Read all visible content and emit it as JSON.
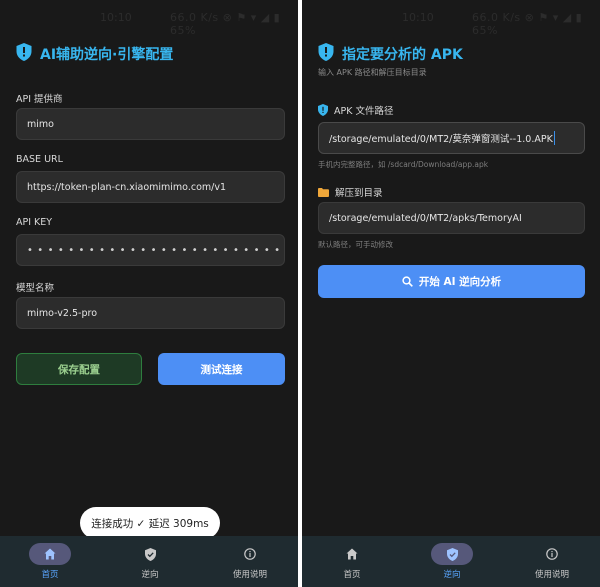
{
  "status_bar": {
    "time": "10:10",
    "icons": "66.0 K/s ⊗ ⚑ ▾ ◢ ▮ 65%"
  },
  "left": {
    "header": {
      "title": "AI辅助逆向·引擎配置"
    },
    "fields": [
      {
        "label": "API 提供商",
        "value": "mimo"
      },
      {
        "label": "BASE URL",
        "value": "https://token-plan-cn.xiaomimimo.com/v1"
      },
      {
        "label": "API KEY",
        "value": "••••••••••••••••••••••••••••••••"
      },
      {
        "label": "模型名称",
        "value": "mimo-v2.5-pro"
      }
    ],
    "buttons": {
      "save": "保存配置",
      "test": "测试连接"
    },
    "toast": "连接成功 ✓ 延迟 309ms",
    "nav": [
      "首页",
      "逆向",
      "使用说明"
    ]
  },
  "right": {
    "header": {
      "title": "指定要分析的 APK",
      "subtitle": "输入 APK 路径和解压目标目录"
    },
    "apk_field": {
      "label": "APK 文件路径",
      "value": "/storage/emulated/0/MT2/莫奈弹窗测试--1.0.APK",
      "hint": "手机内完整路径，如 /sdcard/Download/app.apk"
    },
    "dir_field": {
      "label": "解压到目录",
      "value": "/storage/emulated/0/MT2/apks/TemoryAI",
      "hint": "默认路径，可手动修改"
    },
    "start_button": "开始 AI 逆向分析",
    "nav": [
      "首页",
      "逆向",
      "使用说明"
    ]
  },
  "colors": {
    "accent": "#38b6ef",
    "primary_button": "#4d8ff5",
    "panel_bg": "#191919",
    "nav_bg": "#1f2b30",
    "active_pill": "#56587a"
  }
}
